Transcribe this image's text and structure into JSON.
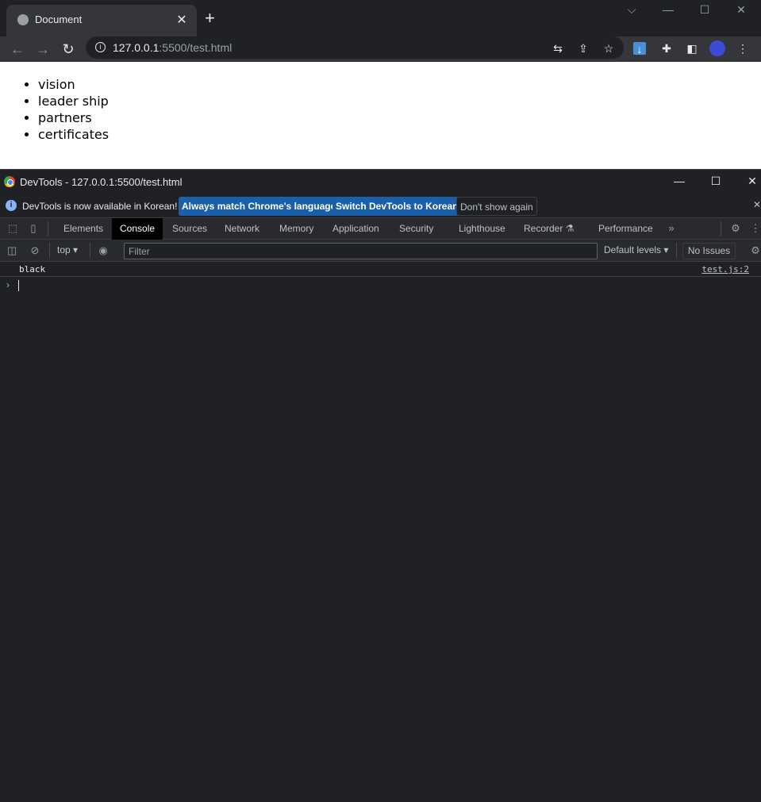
{
  "browser": {
    "tab_title": "Document",
    "tab_close": "✕",
    "new_tab": "+",
    "url_host": "127.0.0.1",
    "url_rest": ":5500/test.html"
  },
  "page": {
    "items": [
      "vision",
      "leader ship",
      "partners",
      "certificates"
    ]
  },
  "devtools": {
    "window_title": "DevTools - 127.0.0.1:5500/test.html",
    "infobar": {
      "message": "DevTools is now available in Korean!",
      "btn_match": "Always match Chrome's language",
      "btn_switch": "Switch DevTools to Korean",
      "btn_dismiss": "Don't show again"
    },
    "tabs": [
      "Elements",
      "Console",
      "Sources",
      "Network",
      "Memory",
      "Application",
      "Security",
      "Lighthouse",
      "Recorder",
      "Performance"
    ],
    "active_tab": "Console",
    "toolbar": {
      "context": "top",
      "filter_placeholder": "Filter",
      "levels": "Default levels",
      "issues": "No Issues"
    },
    "console": {
      "log_message": "black",
      "log_source": "test.js:2"
    }
  }
}
